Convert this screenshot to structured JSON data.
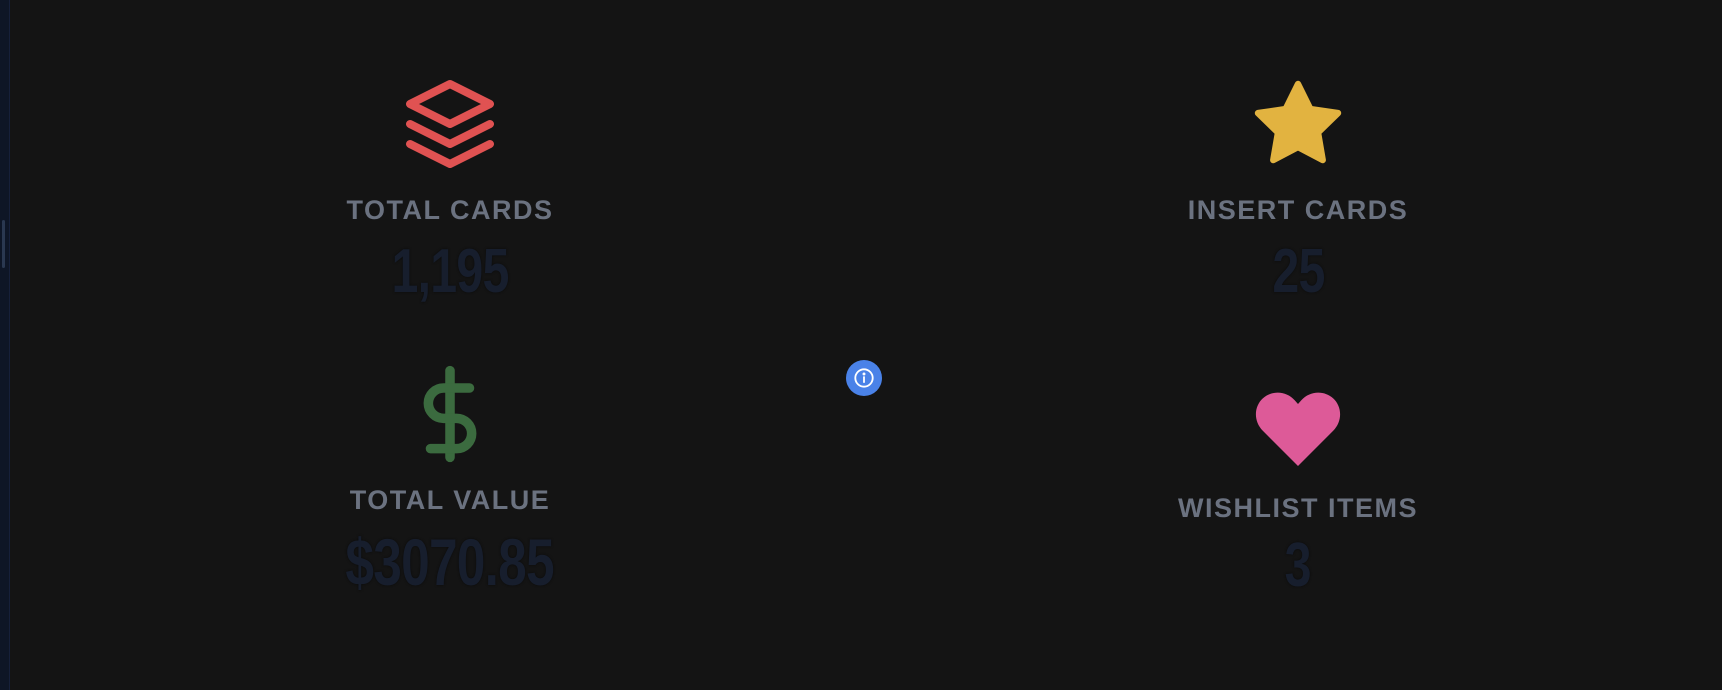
{
  "stats": {
    "total_cards": {
      "label": "TOTAL CARDS",
      "value": "1,195",
      "icon": "layers-icon",
      "color": "#e05252"
    },
    "insert_cards": {
      "label": "INSERT CARDS",
      "value": "25",
      "icon": "star-icon",
      "color": "#e2b340"
    },
    "total_value": {
      "label": "TOTAL VALUE",
      "value": "$3070.85",
      "icon": "dollar-icon",
      "color": "#3b6b3f"
    },
    "wishlist_items": {
      "label": "WISHLIST ITEMS",
      "value": "3",
      "icon": "heart-icon",
      "color": "#dd5a98"
    }
  },
  "info_button": {
    "icon": "info-icon",
    "color": "#4a82e8"
  }
}
